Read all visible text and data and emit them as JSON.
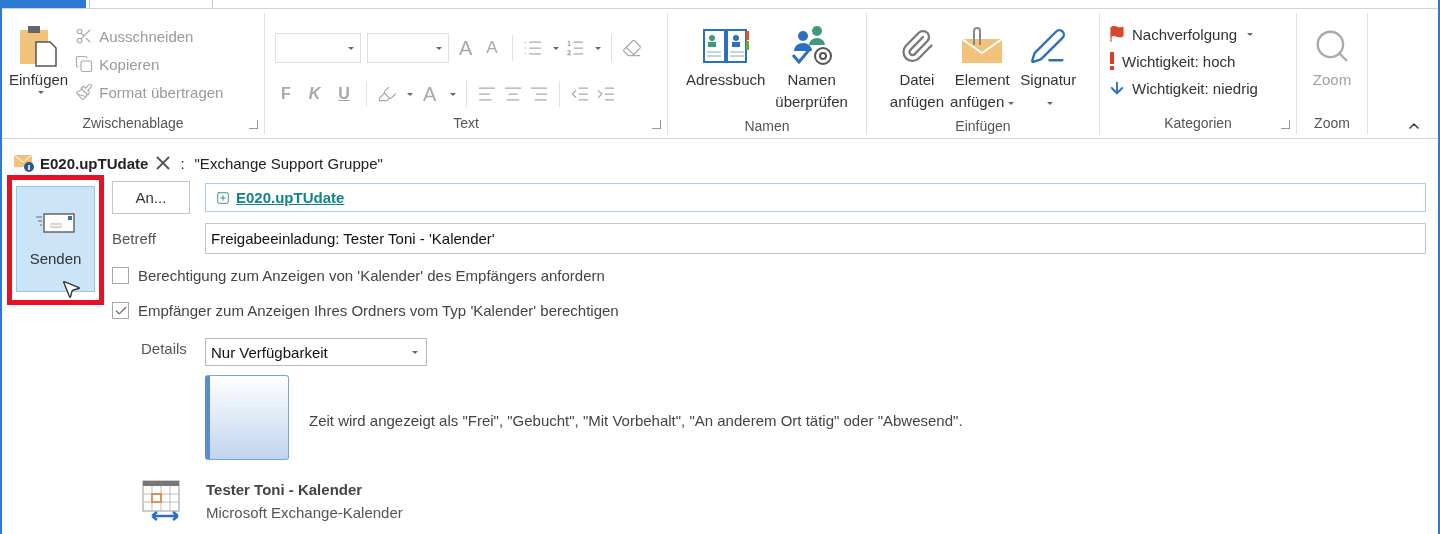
{
  "tabs": [
    {
      "kind": "file",
      "selected": false
    },
    {
      "kind": "message",
      "selected": true
    }
  ],
  "ribbon": {
    "clipboard": {
      "label": "Zwischenablage",
      "paste": "Einfügen",
      "commands": [
        {
          "label": "Ausschneiden",
          "kind": "cut",
          "disabled": true
        },
        {
          "label": "Kopieren",
          "kind": "copy",
          "disabled": true
        },
        {
          "label": "Format übertragen",
          "kind": "brush",
          "disabled": true
        }
      ]
    },
    "text": {
      "label": "Text",
      "font_grow": "A",
      "font_shrink": "A",
      "styles": [
        "F",
        "K",
        "U"
      ],
      "font_color": "A",
      "disabled": true
    },
    "names": {
      "label": "Namen",
      "buttons": [
        {
          "lines": [
            "Adressbuch"
          ],
          "kind": "address-book"
        },
        {
          "lines": [
            "Namen",
            "überprüfen"
          ],
          "kind": "check-names"
        }
      ]
    },
    "insert": {
      "label": "Einfügen",
      "buttons": [
        {
          "lines": [
            "Datei",
            "anfügen"
          ],
          "kind": "attach",
          "dropdown": false
        },
        {
          "lines": [
            "Element",
            "anfügen"
          ],
          "kind": "item",
          "dropdown": true
        },
        {
          "lines": [
            "Signatur"
          ],
          "kind": "signature",
          "dropdown": true
        }
      ]
    },
    "tags": {
      "label": "Kategorien",
      "items": [
        {
          "label": "Nachverfolgung",
          "kind": "flag",
          "dropdown": true
        },
        {
          "label": "Wichtigkeit: hoch",
          "kind": "high",
          "dropdown": false
        },
        {
          "label": "Wichtigkeit: niedrig",
          "kind": "low",
          "dropdown": false
        }
      ]
    },
    "zoom": {
      "label": "Zoom",
      "button": "Zoom",
      "disabled": true
    }
  },
  "message": {
    "sender": "E020.upTUdate",
    "separator": ":",
    "sharing_group": "\"Exchange Support Gruppe\"",
    "send_button": {
      "label": "Senden",
      "highlighted": true
    },
    "to_button": "An...",
    "recipient": "E020.upTUdate",
    "subject_label": "Betreff",
    "subject": "Freigabeeinladung: Tester Toni - 'Kalender'",
    "options": [
      {
        "label": "Berechtigung zum Anzeigen von 'Kalender' des Empfängers anfordern",
        "checked": false
      },
      {
        "label": "Empfänger zum Anzeigen Ihres Ordners vom Typ 'Kalender' berechtigen",
        "checked": true
      }
    ],
    "details": {
      "label": "Details",
      "value": "Nur Verfügbarkeit",
      "description": "Zeit wird angezeigt als \"Frei\", \"Gebucht\", \"Mit Vorbehalt\", \"An anderem Ort tätig\" oder \"Abwesend\"."
    },
    "calendar": {
      "title": "Tester Toni - Kalender",
      "subtitle": "Microsoft Exchange-Kalender"
    }
  }
}
